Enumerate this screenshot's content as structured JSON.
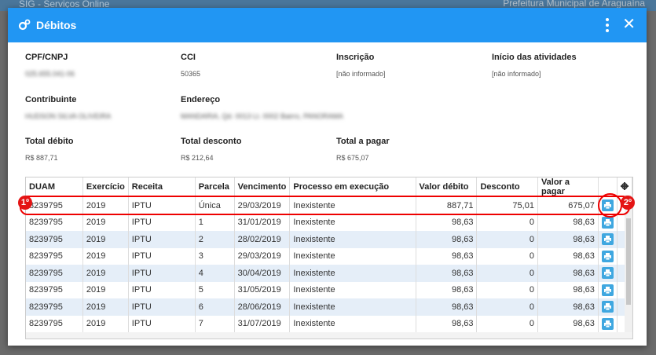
{
  "background": {
    "app_title": "SIG - Serviços Online",
    "org": "Prefeitura Municipal de Araguaína"
  },
  "modal": {
    "title": "Débitos",
    "close_symbol": "✕",
    "fields": {
      "cpf": {
        "label": "CPF/CNPJ",
        "value": "025.655.041-06"
      },
      "cci": {
        "label": "CCI",
        "value": "50365"
      },
      "inscricao": {
        "label": "Inscrição",
        "value": "[não informado]"
      },
      "inicio": {
        "label": "Início das atividades",
        "value": "[não informado]"
      },
      "contribuinte": {
        "label": "Contribuinte",
        "value": "HUDSON SILVA OLIVEIRA"
      },
      "endereco": {
        "label": "Endereço",
        "value": "MANDARIA, Qd. 0013 Lt. 0002 Bairro, PANORAMA"
      },
      "total_debito": {
        "label": "Total débito",
        "value": "R$ 887,71"
      },
      "total_desconto": {
        "label": "Total desconto",
        "value": "R$ 212,64"
      },
      "total_pagar": {
        "label": "Total a pagar",
        "value": "R$ 675,07"
      }
    },
    "table": {
      "headers": [
        "DUAM",
        "Exercício",
        "Receita",
        "Parcela",
        "Vencimento",
        "Processo em execução",
        "Valor débito",
        "Desconto",
        "Valor a pagar"
      ],
      "rows": [
        [
          "8239795",
          "2019",
          "IPTU",
          "Única",
          "29/03/2019",
          "Inexistente",
          "887,71",
          "75,01",
          "675,07"
        ],
        [
          "8239795",
          "2019",
          "IPTU",
          "1",
          "31/01/2019",
          "Inexistente",
          "98,63",
          "0",
          "98,63"
        ],
        [
          "8239795",
          "2019",
          "IPTU",
          "2",
          "28/02/2019",
          "Inexistente",
          "98,63",
          "0",
          "98,63"
        ],
        [
          "8239795",
          "2019",
          "IPTU",
          "3",
          "29/03/2019",
          "Inexistente",
          "98,63",
          "0",
          "98,63"
        ],
        [
          "8239795",
          "2019",
          "IPTU",
          "4",
          "30/04/2019",
          "Inexistente",
          "98,63",
          "0",
          "98,63"
        ],
        [
          "8239795",
          "2019",
          "IPTU",
          "5",
          "31/05/2019",
          "Inexistente",
          "98,63",
          "0",
          "98,63"
        ],
        [
          "8239795",
          "2019",
          "IPTU",
          "6",
          "28/06/2019",
          "Inexistente",
          "98,63",
          "0",
          "98,63"
        ],
        [
          "8239795",
          "2019",
          "IPTU",
          "7",
          "31/07/2019",
          "Inexistente",
          "98,63",
          "0",
          "98,63"
        ]
      ]
    }
  },
  "annotations": {
    "badge1": "1º",
    "badge2": "2º"
  },
  "colors": {
    "header": "#2196f3",
    "marker": "#e00000",
    "print_button": "#3fa7e0"
  }
}
